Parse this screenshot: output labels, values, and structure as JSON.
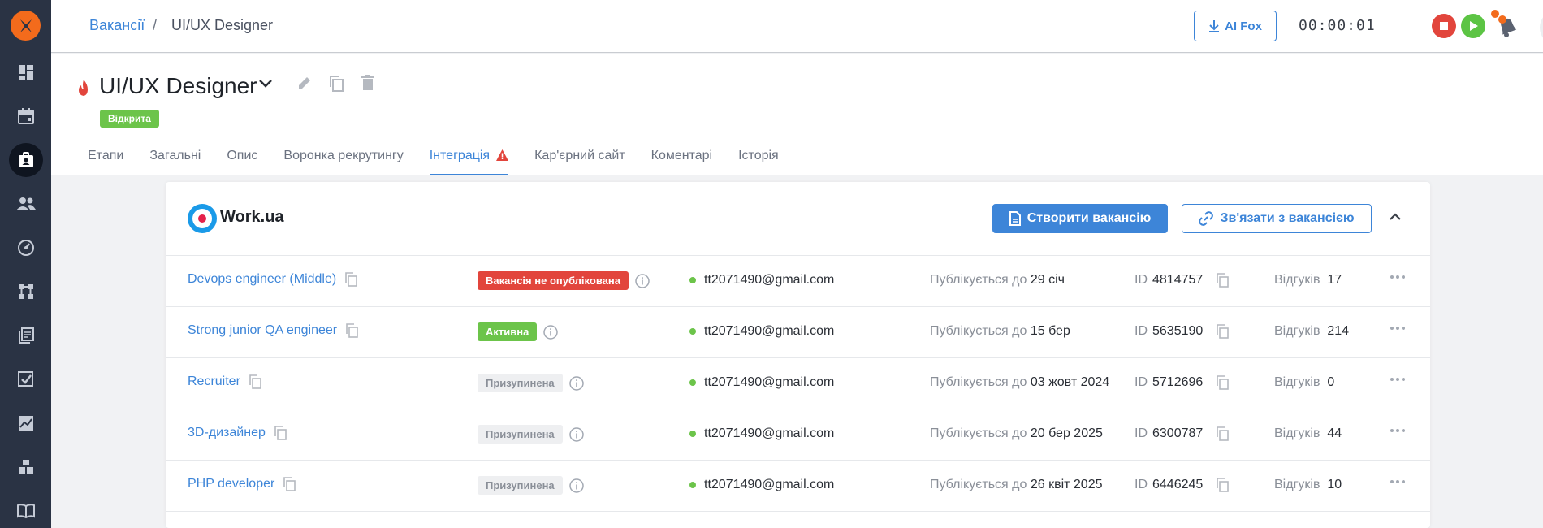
{
  "sidebar": {
    "logo_icon": "fox-logo-icon",
    "items": [
      {
        "name": "dashboard-icon",
        "active": false
      },
      {
        "name": "calendar-icon",
        "active": false
      },
      {
        "name": "vacancies-icon",
        "active": true
      },
      {
        "name": "candidates-icon",
        "active": false
      },
      {
        "name": "speedometer-icon",
        "active": false
      },
      {
        "name": "hierarchy-icon",
        "active": false
      },
      {
        "name": "library-icon",
        "active": false
      },
      {
        "name": "tasks-icon",
        "active": false
      },
      {
        "name": "analytics-icon",
        "active": false
      },
      {
        "name": "blocks-icon",
        "active": false
      },
      {
        "name": "book-icon",
        "active": false
      }
    ]
  },
  "header": {
    "breadcrumb_link": "Вакансії",
    "breadcrumb_sep": "/",
    "breadcrumb_current": "UI/UX Designer",
    "ai_button": "AI Fox",
    "timer": "00:00:01"
  },
  "vacancy": {
    "title": "UI/UX Designer",
    "status": "Відкрита"
  },
  "tabs": [
    {
      "label": "Етапи",
      "active": false
    },
    {
      "label": "Загальні",
      "active": false
    },
    {
      "label": "Опис",
      "active": false
    },
    {
      "label": "Воронка рекрутингу",
      "active": false
    },
    {
      "label": "Інтеграція",
      "active": true,
      "warning": true
    },
    {
      "label": "Кар'єрний сайт",
      "active": false
    },
    {
      "label": "Коментарі",
      "active": false
    },
    {
      "label": "Історія",
      "active": false
    }
  ],
  "integration": {
    "provider": "Work.ua",
    "create_button": "Створити вакансію",
    "link_button": "Зв'язати з вакансією",
    "publishes_until_label": "Публікується до",
    "id_label": "ID",
    "responses_label": "Відгуків",
    "rows": [
      {
        "name": "Devops engineer (Middle)",
        "status": "Вакансія не опублікована",
        "status_type": "red",
        "email": "tt2071490@gmail.com",
        "until": "29 січ",
        "id": "4814757",
        "responses": "17"
      },
      {
        "name": "Strong junior QA engineer",
        "status": "Активна",
        "status_type": "green",
        "email": "tt2071490@gmail.com",
        "until": "15 бер",
        "id": "5635190",
        "responses": "214"
      },
      {
        "name": "Recruiter",
        "status": "Призупинена",
        "status_type": "gray",
        "email": "tt2071490@gmail.com",
        "until": "03 жовт 2024",
        "id": "5712696",
        "responses": "0"
      },
      {
        "name": "3D-дизайнер",
        "status": "Призупинена",
        "status_type": "gray",
        "email": "tt2071490@gmail.com",
        "until": "20 бер 2025",
        "id": "6300787",
        "responses": "44"
      },
      {
        "name": "PHP developer",
        "status": "Призупинена",
        "status_type": "gray",
        "email": "tt2071490@gmail.com",
        "until": "26 квіт 2025",
        "id": "6446245",
        "responses": "10"
      }
    ]
  },
  "colors": {
    "accent": "#3d85d8",
    "sidebar_bg": "#2a3344",
    "brand_orange": "#f36b1c",
    "status_red": "#e2453c",
    "status_green": "#6cc44a"
  }
}
